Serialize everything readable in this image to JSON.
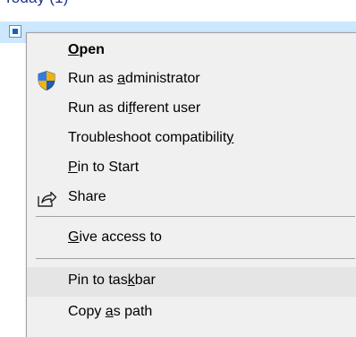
{
  "explorer": {
    "group_header": "Today (1)"
  },
  "menu": {
    "items": [
      {
        "pre": "",
        "key": "O",
        "post": "pen",
        "bold": true,
        "icon": "none"
      },
      {
        "pre": "Run as ",
        "key": "a",
        "post": "dministrator",
        "bold": false,
        "icon": "uac-shield-icon"
      },
      {
        "pre": "Run as di",
        "key": "f",
        "post": "ferent user",
        "bold": false,
        "icon": "none"
      },
      {
        "pre": "Troubleshoot compatibilit",
        "key": "y",
        "post": "",
        "bold": false,
        "icon": "none"
      },
      {
        "pre": "",
        "key": "P",
        "post": "in to Start",
        "bold": false,
        "icon": "none"
      },
      {
        "pre": "Share",
        "key": "",
        "post": "",
        "bold": false,
        "icon": "share-icon"
      },
      {
        "pre": "",
        "key": "G",
        "post": "ive access to",
        "bold": false,
        "icon": "none"
      },
      {
        "pre": "Pin to tas",
        "key": "k",
        "post": "bar",
        "bold": false,
        "icon": "none"
      },
      {
        "pre": "Copy ",
        "key": "a",
        "post": "s path",
        "bold": false,
        "icon": "none"
      }
    ]
  },
  "colors": {
    "menu_background": "#f0f0f0",
    "hover_background": "#e5e5e5",
    "selection_background": "#cce8ff",
    "group_header_color": "#1e3287",
    "shield_blue": "#1c5fb8",
    "shield_gold": "#f2b10c"
  }
}
